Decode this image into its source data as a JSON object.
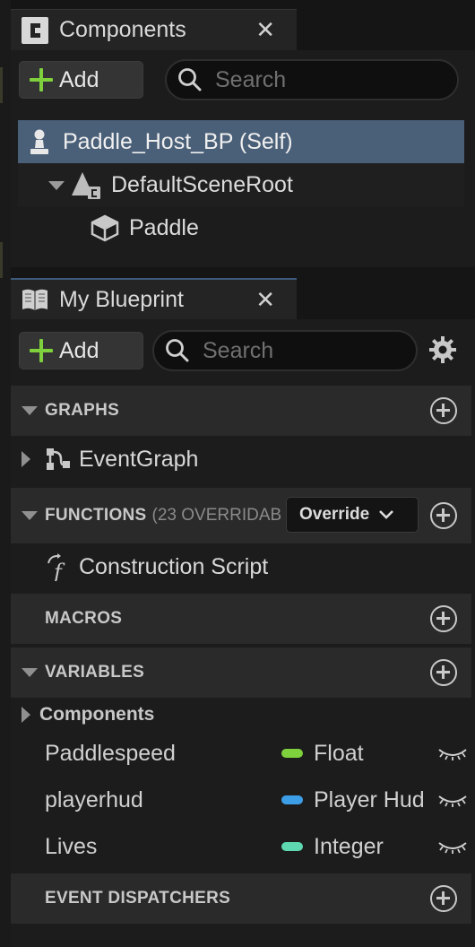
{
  "components_panel": {
    "tab_title": "Components",
    "add_label": "Add",
    "search_placeholder": "Search",
    "tree": {
      "root": "Paddle_Host_BP (Self)",
      "scene_root": "DefaultSceneRoot",
      "child": "Paddle"
    }
  },
  "blueprint_panel": {
    "tab_title": "My Blueprint",
    "add_label": "Add",
    "search_placeholder": "Search",
    "sections": {
      "graphs": {
        "title": "GRAPHS",
        "items": [
          "EventGraph"
        ]
      },
      "functions": {
        "title": "FUNCTIONS",
        "suffix": "(23 OVERRIDAB",
        "override_label": "Override",
        "items": [
          "Construction Script"
        ]
      },
      "macros": {
        "title": "MACROS"
      },
      "variables": {
        "title": "VARIABLES",
        "group": "Components",
        "items": [
          {
            "name": "Paddlespeed",
            "type": "Float",
            "color": "#7ed13d"
          },
          {
            "name": "playerhud",
            "type": "Player Hud",
            "color": "#3d9ee8"
          },
          {
            "name": "Lives",
            "type": "Integer",
            "color": "#5ed8b0"
          }
        ]
      },
      "dispatchers": {
        "title": "EVENT DISPATCHERS"
      }
    }
  },
  "colors": {
    "accent": "#7ed13d",
    "selection": "#4a5f78"
  }
}
